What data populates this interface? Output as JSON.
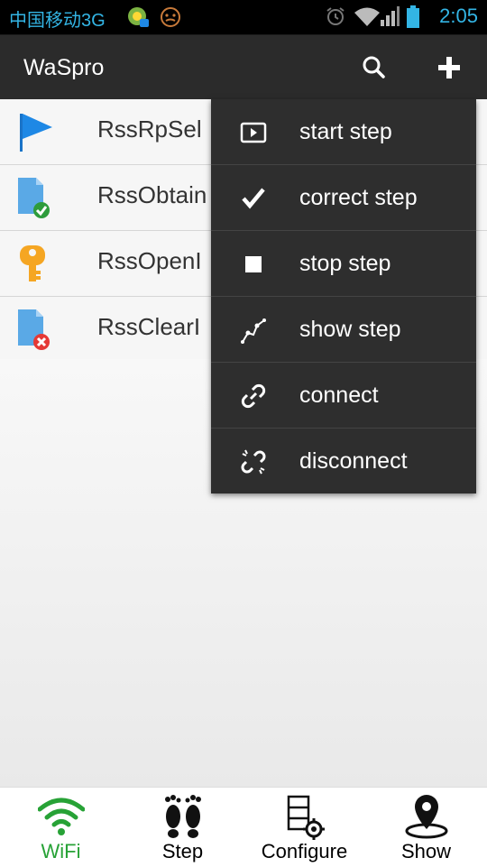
{
  "status_bar": {
    "carrier": "中国移动3G",
    "time": "2:05",
    "icons": [
      "app-notification-icon",
      "face-icon",
      "alarm-icon",
      "wifi-icon",
      "signal-icon",
      "battery-icon"
    ]
  },
  "action_bar": {
    "title": "WaSpro",
    "actions": [
      "search-icon",
      "add-icon"
    ]
  },
  "list": {
    "items": [
      {
        "label": "RssRpSel",
        "icon": "flag-icon"
      },
      {
        "label": "RssObtain",
        "icon": "document-check-icon"
      },
      {
        "label": "RssOpenI",
        "icon": "key-icon"
      },
      {
        "label": "RssClearI",
        "icon": "document-error-icon"
      }
    ]
  },
  "menu": {
    "items": [
      {
        "label": "start step",
        "icon": "play-icon"
      },
      {
        "label": "correct step",
        "icon": "check-icon"
      },
      {
        "label": "stop step",
        "icon": "stop-icon"
      },
      {
        "label": "show step",
        "icon": "path-icon"
      },
      {
        "label": "connect",
        "icon": "link-icon"
      },
      {
        "label": "disconnect",
        "icon": "unlink-icon"
      }
    ]
  },
  "bottom_nav": {
    "items": [
      {
        "label": "WiFi",
        "icon": "wifi-icon",
        "active": true
      },
      {
        "label": "Step",
        "icon": "footprints-icon"
      },
      {
        "label": "Configure",
        "icon": "configure-icon"
      },
      {
        "label": "Show",
        "icon": "location-pin-icon"
      }
    ]
  },
  "colors": {
    "status_text": "#33b5e5",
    "action_bar": "#2b2b2b",
    "menu_bg": "#2e2e2e",
    "active_nav": "#27a236"
  }
}
